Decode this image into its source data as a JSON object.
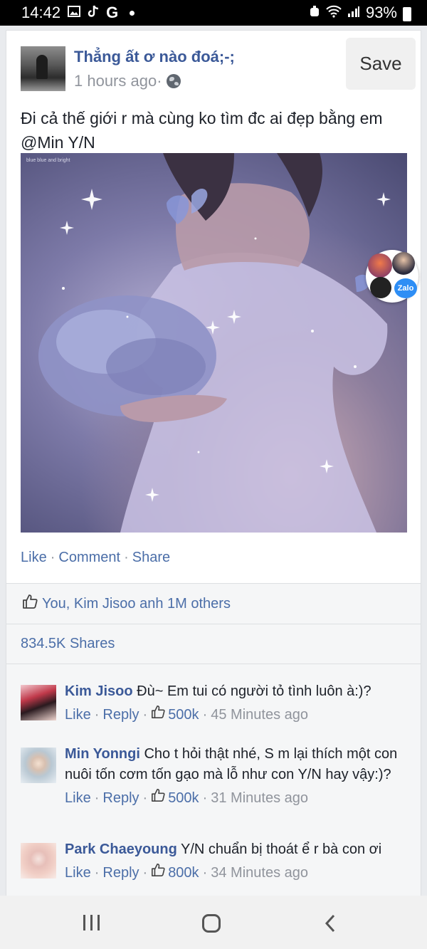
{
  "status_bar": {
    "time": "14:42",
    "battery": "93%",
    "icons": [
      "gallery-icon",
      "tiktok-icon",
      "google-icon",
      "notification-dot",
      "alarm-icon",
      "wifi-icon",
      "signal-icon",
      "battery-icon"
    ]
  },
  "post": {
    "author": "Thẳng ất ơ nào đoá;-;",
    "time": "1 hours ago·",
    "save_label": "Save",
    "text": "Đi cả thế giới r mà cùng ko tìm đc ai đẹp bằng em @Min Y/N",
    "image_caption": "blue blue and bright",
    "actions": {
      "like": "Like",
      "comment": "Comment",
      "share": "Share"
    },
    "likes_text": "You, Kim Jisoo anh 1M others",
    "shares_text": "834.5K Shares"
  },
  "chat_bubble": {
    "label": "Zalo"
  },
  "comments": [
    {
      "name": "Kim Jisoo",
      "text": "Đù~ Em tui có người tỏ tình luôn à:)?",
      "like": "Like",
      "reply": "Reply",
      "count": "500k",
      "time": "45 Minutes ago"
    },
    {
      "name": "Min Yonngi",
      "text": "Cho t hỏi thật nhé, S m lại thích một con nuôi tốn cơm tốn gạo mà lỗ như con Y/N hay vậy:)?",
      "like": "Like",
      "reply": "Reply",
      "count": "500k",
      "time": "31 Minutes ago"
    },
    {
      "name": "Park Chaeyoung",
      "text": "Y/N chuẩn bị thoát ể r bà con ơi",
      "like": "Like",
      "reply": "Reply",
      "count": "800k",
      "time": "34 Minutes ago"
    }
  ],
  "colors": {
    "link": "#3b5998",
    "secondary": "#90949c",
    "action": "#4b6ea8"
  }
}
